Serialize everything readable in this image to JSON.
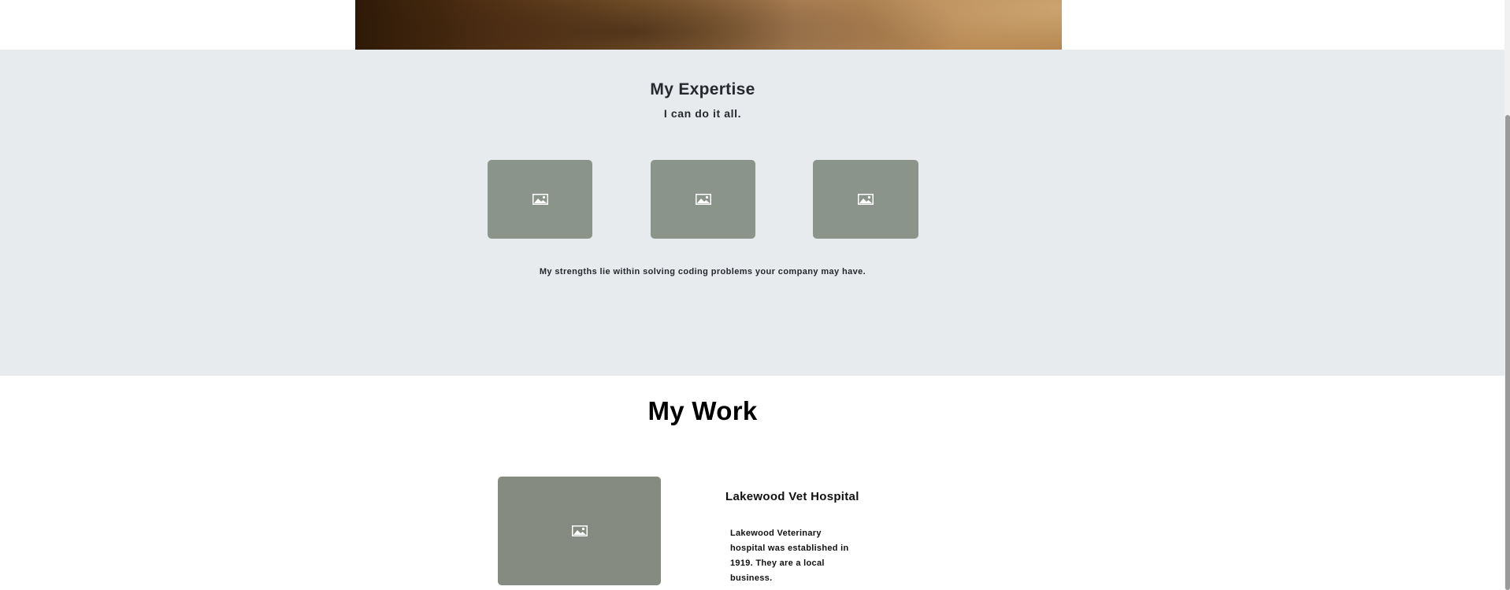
{
  "expertise": {
    "title": "My Expertise",
    "subtitle": "I can do it all.",
    "cards": [
      {
        "icon": "image-placeholder-icon"
      },
      {
        "icon": "image-placeholder-icon"
      },
      {
        "icon": "image-placeholder-icon"
      }
    ],
    "description": "My strengths lie within solving coding problems your company may have.",
    "background": "#e7ebee"
  },
  "work": {
    "title": "My Work",
    "projects": [
      {
        "icon": "image-placeholder-icon",
        "title": "Lakewood Vet Hospital",
        "description": "Lakewood Veterinary hospital was established in 1919. They are a local business."
      }
    ]
  },
  "colors": {
    "card": "#8a948b",
    "work_card": "#868b82",
    "text": "#262a2e"
  }
}
